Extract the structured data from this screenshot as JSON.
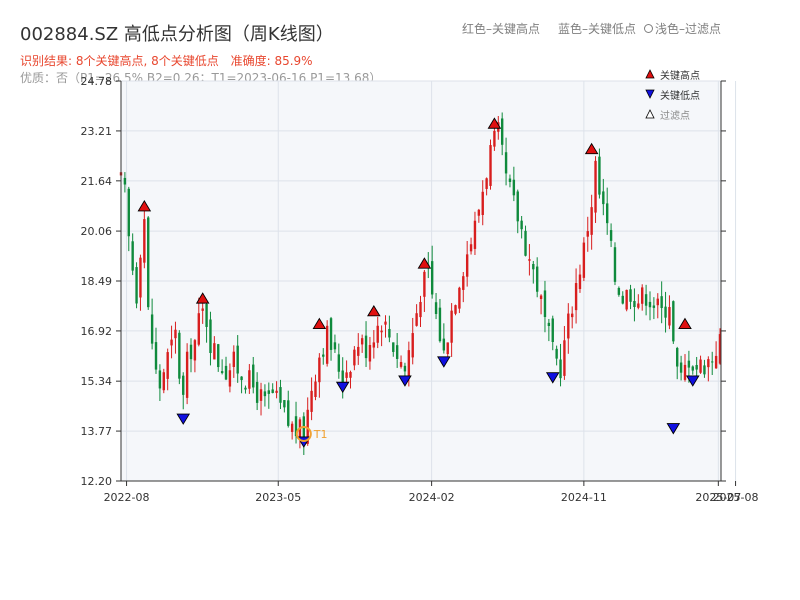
{
  "header": {
    "title": "002884.SZ 高低点分析图（周K线图）",
    "legend_red": "红色–关键高点",
    "legend_blue": "蓝色–关键低点",
    "legend_light": "浅色–过滤点",
    "result": "识别结果: 8个关键高点, 8个关键低点",
    "accuracy": "准确度: 85.9%",
    "quality": "优质：否（P1=26.5%  B2=0.26；T1=2023-06-16 P1=13.68）"
  },
  "legend": {
    "high_label": "关键高点",
    "low_label": "关键低点",
    "filtered_label": "过滤点"
  },
  "colors": {
    "up": "#d81e1e",
    "down": "#0f8a3c",
    "high_marker": "#e01010",
    "low_marker": "#1010e0",
    "t1_ring": "#f0a030",
    "plot_bg": "#f5f7fa",
    "grid": "#dde2ea"
  },
  "chart_data": {
    "type": "candlestick",
    "title": "002884.SZ 高低点分析图（周K线图）",
    "xlabel": "",
    "ylabel": "",
    "ylim": [
      12.2,
      24.78
    ],
    "yticks": [
      12.2,
      13.77,
      15.34,
      16.92,
      18.49,
      20.06,
      21.64,
      23.21,
      24.78
    ],
    "x_range": [
      "2022-07-22",
      "2025-07-04"
    ],
    "xticks": [
      "2022-08",
      "2023-05",
      "2024-02",
      "2024-11",
      "2025-07",
      "2025-08"
    ],
    "grid": true,
    "close_path": [
      [
        "2022-07-22",
        21.6
      ],
      [
        "2022-07-29",
        21.2
      ],
      [
        "2022-08-05",
        19.8
      ],
      [
        "2022-08-12",
        18.9
      ],
      [
        "2022-08-19",
        18.1
      ],
      [
        "2022-08-26",
        19.6
      ],
      [
        "2022-09-02",
        20.5
      ],
      [
        "2022-09-09",
        17.5
      ],
      [
        "2022-09-16",
        16.6
      ],
      [
        "2022-09-23",
        15.6
      ],
      [
        "2022-09-30",
        15.2
      ],
      [
        "2022-10-07",
        15.7
      ],
      [
        "2022-10-14",
        16.1
      ],
      [
        "2022-10-21",
        16.4
      ],
      [
        "2022-10-28",
        16.8
      ],
      [
        "2022-11-04",
        15.6
      ],
      [
        "2022-11-11",
        14.8
      ],
      [
        "2022-11-18",
        15.9
      ],
      [
        "2022-11-25",
        16.4
      ],
      [
        "2022-12-02",
        16.6
      ],
      [
        "2022-12-09",
        17.2
      ],
      [
        "2022-12-16",
        17.5
      ],
      [
        "2022-12-23",
        17.3
      ],
      [
        "2022-12-30",
        16.6
      ],
      [
        "2023-01-13",
        16.0
      ],
      [
        "2023-01-27",
        15.7
      ],
      [
        "2023-02-10",
        15.9
      ],
      [
        "2023-02-24",
        15.6
      ],
      [
        "2023-03-10",
        15.3
      ],
      [
        "2023-03-24",
        15.0
      ],
      [
        "2023-04-07",
        14.6
      ],
      [
        "2023-04-21",
        14.9
      ],
      [
        "2023-05-05",
        14.5
      ],
      [
        "2023-05-19",
        14.0
      ],
      [
        "2023-06-02",
        13.8
      ],
      [
        "2023-06-16",
        13.7
      ],
      [
        "2023-06-23",
        14.4
      ],
      [
        "2023-06-30",
        15.2
      ],
      [
        "2023-07-14",
        16.2
      ],
      [
        "2023-07-28",
        16.8
      ],
      [
        "2023-08-11",
        16.1
      ],
      [
        "2023-08-25",
        15.5
      ],
      [
        "2023-09-08",
        16.0
      ],
      [
        "2023-09-22",
        16.6
      ],
      [
        "2023-10-06",
        16.4
      ],
      [
        "2023-10-20",
        16.9
      ],
      [
        "2023-11-03",
        17.3
      ],
      [
        "2023-11-17",
        16.8
      ],
      [
        "2023-12-01",
        16.2
      ],
      [
        "2023-12-15",
        15.7
      ],
      [
        "2023-12-29",
        16.9
      ],
      [
        "2024-01-12",
        18.2
      ],
      [
        "2024-01-26",
        18.7
      ],
      [
        "2024-02-09",
        17.4
      ],
      [
        "2024-02-23",
        16.2
      ],
      [
        "2024-03-08",
        17.6
      ],
      [
        "2024-03-22",
        18.6
      ],
      [
        "2024-04-05",
        19.4
      ],
      [
        "2024-04-19",
        20.2
      ],
      [
        "2024-05-03",
        21.4
      ],
      [
        "2024-05-17",
        22.6
      ],
      [
        "2024-05-31",
        23.1
      ],
      [
        "2024-06-14",
        21.7
      ],
      [
        "2024-06-28",
        20.9
      ],
      [
        "2024-07-12",
        20.1
      ],
      [
        "2024-07-26",
        19.2
      ],
      [
        "2024-08-09",
        18.4
      ],
      [
        "2024-08-23",
        17.2
      ],
      [
        "2024-09-06",
        16.2
      ],
      [
        "2024-09-20",
        15.8
      ],
      [
        "2024-10-04",
        17.2
      ],
      [
        "2024-10-18",
        18.4
      ],
      [
        "2024-11-01",
        19.5
      ],
      [
        "2024-11-15",
        21.0
      ],
      [
        "2024-11-22",
        22.1
      ],
      [
        "2024-11-29",
        21.2
      ],
      [
        "2024-12-13",
        20.2
      ],
      [
        "2024-12-27",
        18.6
      ],
      [
        "2025-01-10",
        18.0
      ],
      [
        "2025-01-24",
        18.2
      ],
      [
        "2025-02-07",
        17.9
      ],
      [
        "2025-02-21",
        18.1
      ],
      [
        "2025-03-07",
        17.8
      ],
      [
        "2025-03-21",
        17.5
      ],
      [
        "2025-04-04",
        17.9
      ],
      [
        "2025-04-11",
        16.5
      ],
      [
        "2025-04-18",
        15.6
      ],
      [
        "2025-04-25",
        15.4
      ],
      [
        "2025-05-09",
        16.1
      ],
      [
        "2025-05-23",
        15.8
      ],
      [
        "2025-06-06",
        15.9
      ],
      [
        "2025-06-20",
        16.1
      ],
      [
        "2025-06-27",
        16.4
      ],
      [
        "2025-07-04",
        16.6
      ]
    ],
    "key_highs": [
      {
        "date": "2022-09-02",
        "price": 20.6
      },
      {
        "date": "2022-12-16",
        "price": 17.7
      },
      {
        "date": "2023-07-14",
        "price": 16.9
      },
      {
        "date": "2023-10-20",
        "price": 17.3
      },
      {
        "date": "2024-01-19",
        "price": 18.8
      },
      {
        "date": "2024-05-24",
        "price": 23.2
      },
      {
        "date": "2024-11-15",
        "price": 22.4
      },
      {
        "date": "2025-05-02",
        "price": 16.9
      }
    ],
    "key_lows": [
      {
        "date": "2022-11-11",
        "price": 14.4
      },
      {
        "date": "2023-06-16",
        "price": 13.68
      },
      {
        "date": "2023-08-25",
        "price": 15.4
      },
      {
        "date": "2023-12-15",
        "price": 15.6
      },
      {
        "date": "2024-02-23",
        "price": 16.2
      },
      {
        "date": "2024-09-06",
        "price": 15.7
      },
      {
        "date": "2025-04-11",
        "price": 14.1
      },
      {
        "date": "2025-05-16",
        "price": 15.6
      }
    ],
    "t1": {
      "label": "T1",
      "date": "2023-06-16",
      "price": 13.68
    }
  }
}
